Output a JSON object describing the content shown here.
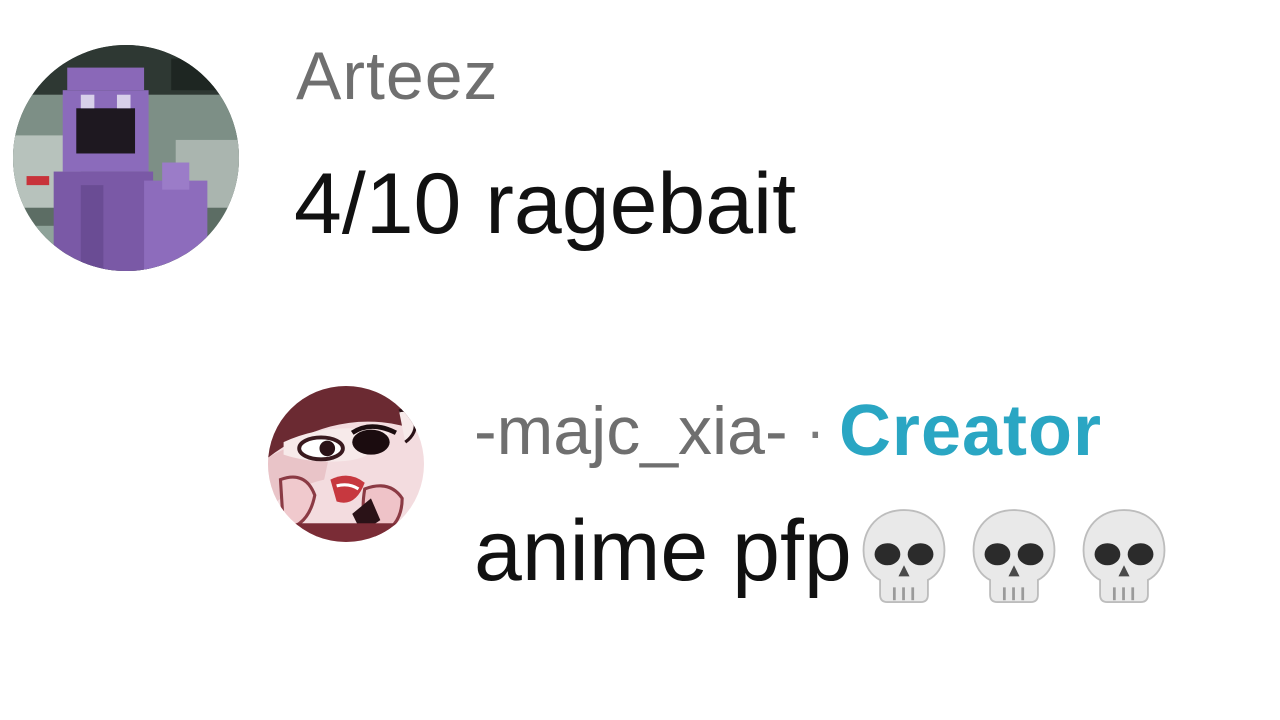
{
  "comments": [
    {
      "username": "Arteez",
      "text": "4/10 ragebait",
      "avatar_icon": "pixel-art-purple-character-avatar"
    },
    {
      "username": "-majc_xia-",
      "separator": "·",
      "badge": "Creator",
      "text": "anime pfp",
      "emojis": [
        "skull-emoji",
        "skull-emoji",
        "skull-emoji"
      ],
      "avatar_icon": "anime-character-avatar"
    }
  ],
  "colors": {
    "username": "#6f6f6f",
    "body_text": "#111111",
    "creator_badge": "#2aa6c3",
    "background": "#ffffff"
  }
}
